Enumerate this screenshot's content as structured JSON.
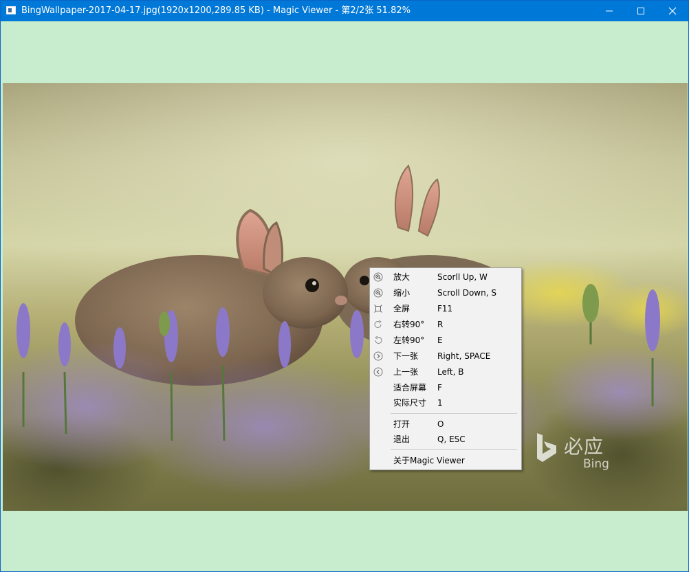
{
  "window": {
    "title": "BingWallpaper-2017-04-17.jpg(1920x1200,289.85 KB) - Magic Viewer - 第2/2张 51.82%",
    "background": "#c8ecce",
    "titlebar_color": "#0078d7"
  },
  "controls": {
    "minimize": "minimize-icon",
    "maximize": "maximize-icon",
    "close": "close-icon"
  },
  "watermark": {
    "cn": "必应",
    "en": "Bing"
  },
  "menu": {
    "items": [
      {
        "label": "放大",
        "shortcut": "Scorll Up, W",
        "icon": "zoom-in-icon"
      },
      {
        "label": "缩小",
        "shortcut": "Scroll Down, S",
        "icon": "zoom-out-icon"
      },
      {
        "label": "全屏",
        "shortcut": "F11",
        "icon": "fullscreen-icon"
      },
      {
        "label": "右转90°",
        "shortcut": "R",
        "icon": "rotate-right-icon"
      },
      {
        "label": "左转90°",
        "shortcut": "E",
        "icon": "rotate-left-icon"
      },
      {
        "label": "下一张",
        "shortcut": "Right, SPACE",
        "icon": "next-icon"
      },
      {
        "label": "上一张",
        "shortcut": "Left, B",
        "icon": "previous-icon"
      },
      {
        "label": "适合屏幕",
        "shortcut": "F"
      },
      {
        "label": "实际尺寸",
        "shortcut": "1"
      },
      {
        "label": "打开",
        "shortcut": "O"
      },
      {
        "label": "退出",
        "shortcut": "Q, ESC"
      },
      {
        "label": "关于Magic Viewer",
        "shortcut": ""
      }
    ]
  }
}
